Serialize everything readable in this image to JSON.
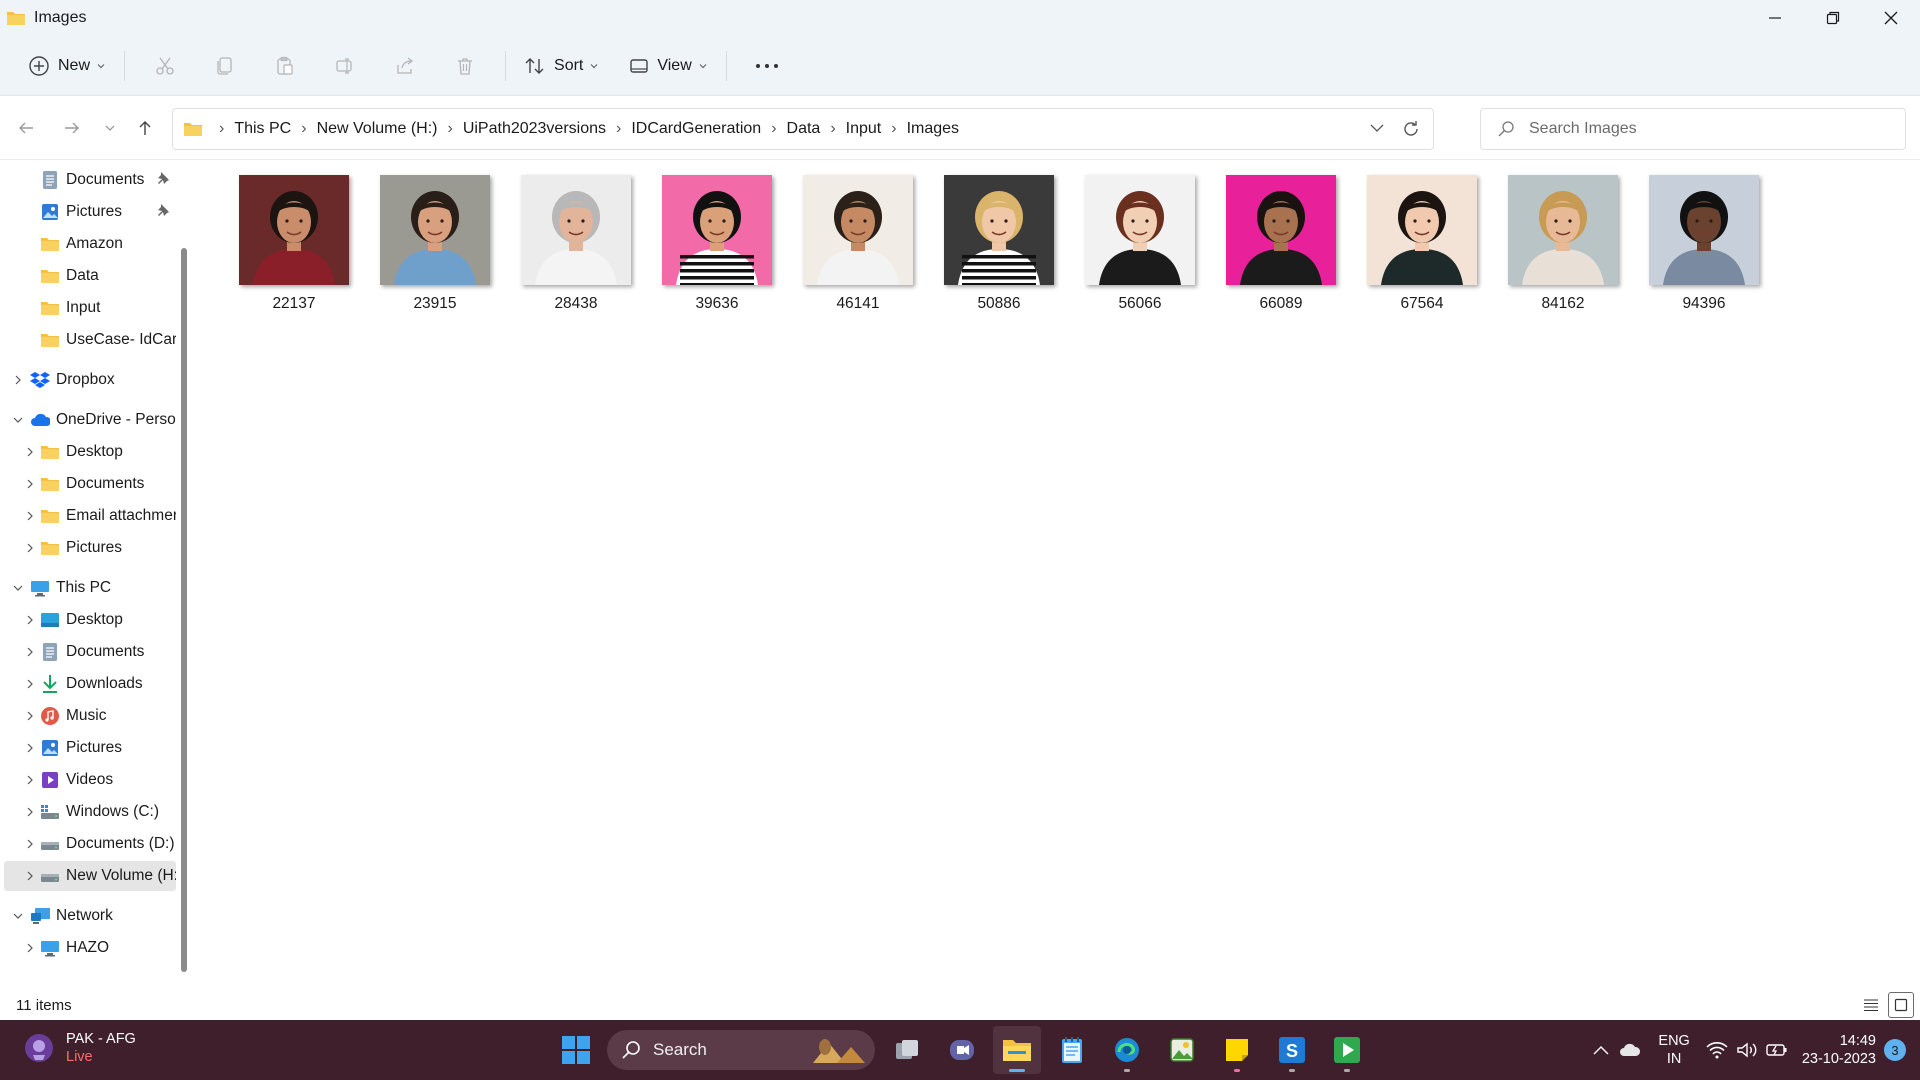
{
  "window": {
    "title": "Images",
    "icon": "folder-icon",
    "controls": [
      "minimize-icon",
      "restore-icon",
      "close-icon"
    ]
  },
  "toolbar": {
    "new_label": "New",
    "sort_label": "Sort",
    "view_label": "View",
    "icons": [
      "cut-icon",
      "copy-icon",
      "paste-icon",
      "rename-icon",
      "share-icon",
      "delete-icon",
      "more-icon"
    ]
  },
  "address": {
    "breadcrumbs": [
      "This PC",
      "New Volume (H:)",
      "UiPath2023versions",
      "IDCardGeneration",
      "Data",
      "Input",
      "Images"
    ]
  },
  "search": {
    "placeholder": "Search Images"
  },
  "sidebar": {
    "items": [
      {
        "label": "Documents",
        "icon": "documents-icon",
        "pinned": true
      },
      {
        "label": "Pictures",
        "icon": "pictures-icon",
        "pinned": true
      },
      {
        "label": "Amazon",
        "icon": "folder-icon"
      },
      {
        "label": "Data",
        "icon": "folder-icon"
      },
      {
        "label": "Input",
        "icon": "folder-icon"
      },
      {
        "label": "UseCase- IdCard",
        "icon": "folder-icon"
      },
      {
        "label": "Dropbox",
        "icon": "dropbox-icon"
      },
      {
        "label": "OneDrive - Person",
        "icon": "onedrive-icon"
      },
      {
        "label": "Desktop",
        "icon": "folder-icon"
      },
      {
        "label": "Documents",
        "icon": "folder-icon"
      },
      {
        "label": "Email attachmer",
        "icon": "folder-icon"
      },
      {
        "label": "Pictures",
        "icon": "folder-icon"
      },
      {
        "label": "This PC",
        "icon": "computer-icon"
      },
      {
        "label": "Desktop",
        "icon": "desktop-icon"
      },
      {
        "label": "Documents",
        "icon": "documents-icon"
      },
      {
        "label": "Downloads",
        "icon": "downloads-icon"
      },
      {
        "label": "Music",
        "icon": "music-icon"
      },
      {
        "label": "Pictures",
        "icon": "pictures-icon"
      },
      {
        "label": "Videos",
        "icon": "videos-icon"
      },
      {
        "label": "Windows (C:)",
        "icon": "drive-icon"
      },
      {
        "label": "Documents (D:)",
        "icon": "drive-icon"
      },
      {
        "label": "New Volume (H:",
        "icon": "drive-icon",
        "selected": true
      },
      {
        "label": "Network",
        "icon": "network-icon"
      },
      {
        "label": "HAZO",
        "icon": "computer-icon"
      }
    ]
  },
  "files": [
    {
      "name": "22137",
      "bg": "#6a2a2a"
    },
    {
      "name": "23915",
      "bg": "#9a9a92"
    },
    {
      "name": "28438",
      "bg": "#ececec"
    },
    {
      "name": "39636",
      "bg": "#f26aa8"
    },
    {
      "name": "46141",
      "bg": "#f2ece6"
    },
    {
      "name": "50886",
      "bg": "#3a3a3a"
    },
    {
      "name": "56066",
      "bg": "#f2f2f2"
    },
    {
      "name": "66089",
      "bg": "#e8209a"
    },
    {
      "name": "67564",
      "bg": "#f3e3d6"
    },
    {
      "name": "84162",
      "bg": "#b9c4c6"
    },
    {
      "name": "94396",
      "bg": "#c7cfdb"
    }
  ],
  "status": {
    "item_count": "11 items"
  },
  "taskbar": {
    "weather_title": "PAK - AFG",
    "weather_sub": "Live",
    "search_label": "Search",
    "apps": [
      "task-view-icon",
      "teams-icon",
      "file-explorer-icon",
      "notepad-icon",
      "edge-icon",
      "image-app-icon",
      "sticky-notes-icon",
      "uipath-studio-icon",
      "uipath-assistant-icon"
    ],
    "lang_top": "ENG",
    "lang_bottom": "IN",
    "time": "14:49",
    "date": "23-10-2023",
    "notifications": "3"
  },
  "colors": {
    "titlebar": "#eff4f9",
    "taskbar": "#3f1f2c",
    "folder": "#f4c13f",
    "accent": "#5fb2f2"
  }
}
